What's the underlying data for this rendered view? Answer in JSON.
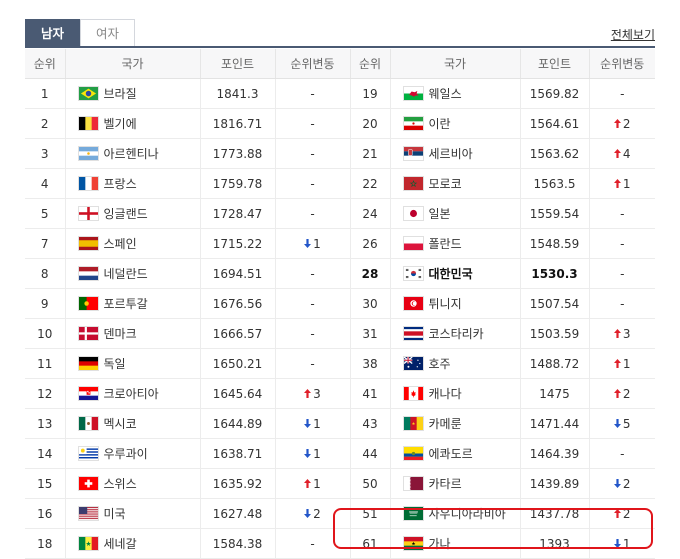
{
  "tabs": [
    {
      "label": "남자",
      "active": true
    },
    {
      "label": "여자",
      "active": false
    }
  ],
  "view_all": "전체보기",
  "headers": [
    "순위",
    "국가",
    "포인트",
    "순위변동",
    "순위",
    "국가",
    "포인트",
    "순위변동"
  ],
  "colors": {
    "tab_active": "#4a5a73",
    "up": "#e0202a",
    "down": "#2356c9",
    "highlight_border": "#e0151b"
  },
  "left_rows": [
    {
      "rank": "1",
      "name": "브라질",
      "flag": "brazil",
      "points": "1841.3",
      "change": "-"
    },
    {
      "rank": "2",
      "name": "벨기에",
      "flag": "belgium",
      "points": "1816.71",
      "change": "-"
    },
    {
      "rank": "3",
      "name": "아르헨티나",
      "flag": "argentina",
      "points": "1773.88",
      "change": "-"
    },
    {
      "rank": "4",
      "name": "프랑스",
      "flag": "france",
      "points": "1759.78",
      "change": "-"
    },
    {
      "rank": "5",
      "name": "잉글랜드",
      "flag": "england",
      "points": "1728.47",
      "change": "-"
    },
    {
      "rank": "7",
      "name": "스페인",
      "flag": "spain",
      "points": "1715.22",
      "change": "↓1"
    },
    {
      "rank": "8",
      "name": "네덜란드",
      "flag": "netherlands",
      "points": "1694.51",
      "change": "-"
    },
    {
      "rank": "9",
      "name": "포르투갈",
      "flag": "portugal",
      "points": "1676.56",
      "change": "-"
    },
    {
      "rank": "10",
      "name": "덴마크",
      "flag": "denmark",
      "points": "1666.57",
      "change": "-"
    },
    {
      "rank": "11",
      "name": "독일",
      "flag": "germany",
      "points": "1650.21",
      "change": "-"
    },
    {
      "rank": "12",
      "name": "크로아티아",
      "flag": "croatia",
      "points": "1645.64",
      "change": "↑3"
    },
    {
      "rank": "13",
      "name": "멕시코",
      "flag": "mexico",
      "points": "1644.89",
      "change": "↓1"
    },
    {
      "rank": "14",
      "name": "우루과이",
      "flag": "uruguay",
      "points": "1638.71",
      "change": "↓1"
    },
    {
      "rank": "15",
      "name": "스위스",
      "flag": "switzerland",
      "points": "1635.92",
      "change": "↑1"
    },
    {
      "rank": "16",
      "name": "미국",
      "flag": "usa",
      "points": "1627.48",
      "change": "↓2"
    },
    {
      "rank": "18",
      "name": "세네갈",
      "flag": "senegal",
      "points": "1584.38",
      "change": "-"
    }
  ],
  "right_rows": [
    {
      "rank": "19",
      "name": "웨일스",
      "flag": "wales",
      "points": "1569.82",
      "change": "-"
    },
    {
      "rank": "20",
      "name": "이란",
      "flag": "iran",
      "points": "1564.61",
      "change": "↑2"
    },
    {
      "rank": "21",
      "name": "세르비아",
      "flag": "serbia",
      "points": "1563.62",
      "change": "↑4"
    },
    {
      "rank": "22",
      "name": "모로코",
      "flag": "morocco",
      "points": "1563.5",
      "change": "↑1"
    },
    {
      "rank": "24",
      "name": "일본",
      "flag": "japan",
      "points": "1559.54",
      "change": "-"
    },
    {
      "rank": "26",
      "name": "폴란드",
      "flag": "poland",
      "points": "1548.59",
      "change": "-"
    },
    {
      "rank": "28",
      "name": "대한민국",
      "flag": "korea",
      "points": "1530.3",
      "change": "-",
      "bold": true
    },
    {
      "rank": "30",
      "name": "튀니지",
      "flag": "tunisia",
      "points": "1507.54",
      "change": "-"
    },
    {
      "rank": "31",
      "name": "코스타리카",
      "flag": "costarica",
      "points": "1503.59",
      "change": "↑3"
    },
    {
      "rank": "38",
      "name": "호주",
      "flag": "australia",
      "points": "1488.72",
      "change": "↑1"
    },
    {
      "rank": "41",
      "name": "캐나다",
      "flag": "canada",
      "points": "1475",
      "change": "↑2"
    },
    {
      "rank": "43",
      "name": "카메룬",
      "flag": "cameroon",
      "points": "1471.44",
      "change": "↓5"
    },
    {
      "rank": "44",
      "name": "에콰도르",
      "flag": "ecuador",
      "points": "1464.39",
      "change": "-"
    },
    {
      "rank": "50",
      "name": "카타르",
      "flag": "qatar",
      "points": "1439.89",
      "change": "↓2"
    },
    {
      "rank": "51",
      "name": "사우디아라비아",
      "flag": "saudi",
      "points": "1437.78",
      "change": "↑2"
    },
    {
      "rank": "61",
      "name": "가나",
      "flag": "ghana",
      "points": "1393",
      "change": "↓1"
    }
  ]
}
